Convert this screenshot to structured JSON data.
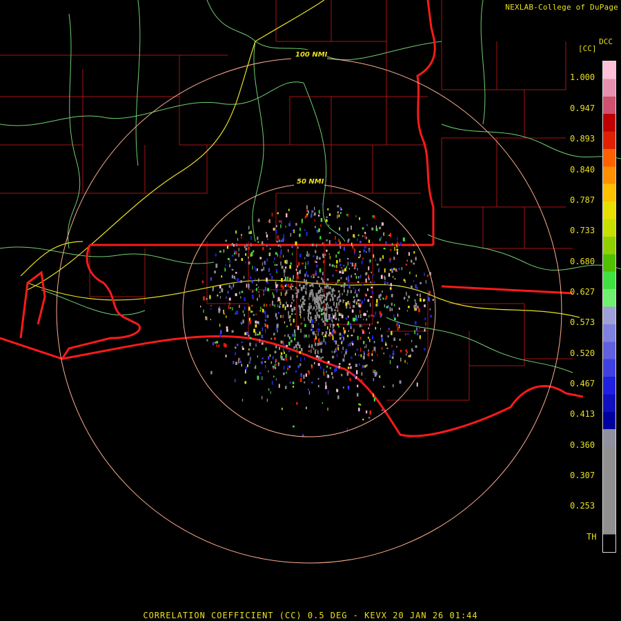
{
  "header": {
    "credit": "NEXLAB-College of DuPage",
    "credit_tag": "DCC",
    "unit": "[CC]"
  },
  "range_rings": [
    {
      "label": "100 NMI",
      "radius_nmi": 100
    },
    {
      "label": "50 NMI",
      "radius_nmi": 50
    }
  ],
  "legend": {
    "ticks": [
      "1.000",
      "0.947",
      "0.893",
      "0.840",
      "0.787",
      "0.733",
      "0.680",
      "0.627",
      "0.573",
      "0.520",
      "0.467",
      "0.413",
      "0.360",
      "0.307",
      "0.253",
      "TH"
    ],
    "colors_top_to_bottom": [
      "#ffc0d8",
      "#e890b0",
      "#d05070",
      "#c00000",
      "#e02000",
      "#ff6000",
      "#ff9000",
      "#ffc000",
      "#e8e000",
      "#c8e000",
      "#90d000",
      "#50c000",
      "#40e040",
      "#70f070",
      "#a0a0d8",
      "#8080e0",
      "#6060e0",
      "#4040e0",
      "#2020e0",
      "#1010c0",
      "#0000a0",
      "#9090a0",
      "#909090",
      "#909090",
      "#909090",
      "#909090",
      "#909090",
      "#000000"
    ]
  },
  "footer": {
    "title": "CORRELATION COEFFICIENT (CC) 0.5 DEG - KEVX 20 JAN 26 01:44"
  },
  "colors": {
    "background": "#000000",
    "county_lines": "#b01818",
    "state_lines": "#ff1a1a",
    "highways": "#70d070",
    "interstates": "#e8e020",
    "range_rings": "#ffb090",
    "text": "#e8e020"
  }
}
